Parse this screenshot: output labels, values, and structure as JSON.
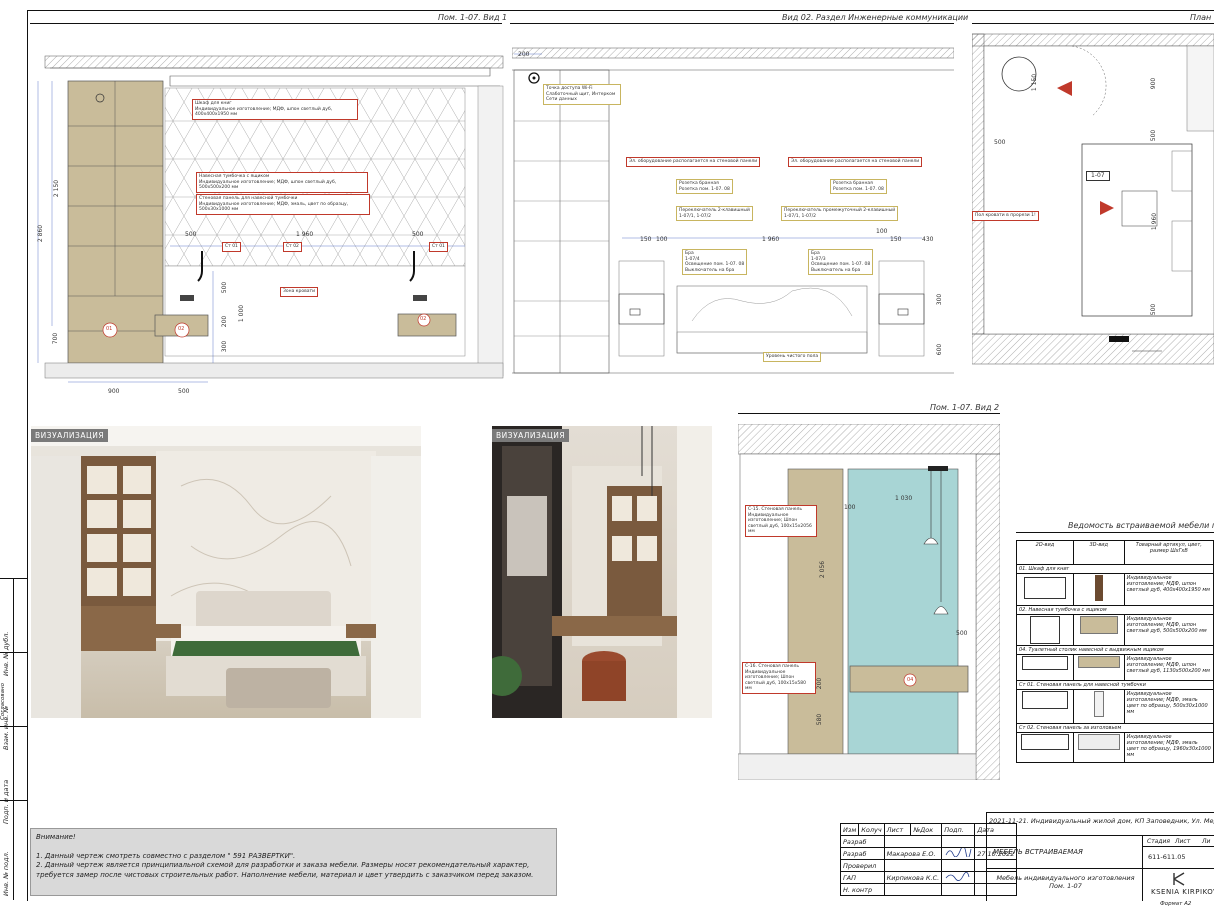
{
  "views": {
    "view1_title": "Пом. 1-07. Вид 1",
    "view2_title": "Вид 02. Раздел Инженерные коммуникации",
    "view3_title": "План",
    "view4_title": "Пом. 1-07. Вид 2",
    "specs_title": "Ведомость встраиваемой мебели по"
  },
  "view1": {
    "notes": {
      "n1": "Шкаф для книг\nИндивидуальное изготовление; МДФ, шпон светлый дуб, 400х400х1950 мм",
      "n2": "Навесная тумбочка с ящиком\nИндивидуальное изготовление; МДФ, шпон светлый дуб, 500х500х200 мм",
      "n3": "Стеновая панель для навесной тумбочки\nИндивидуальное изготовление; МДФ, эмаль, цвет по образцу, 500х30х1000 мм",
      "st01a": "Ст 01",
      "st02": "Ст 02",
      "st01b": "Ст 01",
      "bed_zone": "Зона кровати"
    },
    "dims": {
      "d2860": "2 860",
      "d2150": "2 150",
      "d1960": "1 960",
      "d500a": "500",
      "d500b": "500",
      "d500c": "500",
      "d1000": "1 000",
      "d200": "200",
      "d300": "300",
      "d700": "700",
      "d900": "900",
      "d500d": "500"
    },
    "tags": {
      "t01": "01",
      "t02": "02",
      "t02b": "02"
    }
  },
  "view2": {
    "notes": {
      "wifi": "Точка доступа Wi-Fi\nСлаботочный щит, Интерком\nСети данных",
      "equip_left": "Эл. оборудование располагается на стеновой панели",
      "equip_right": "Эл. оборудование располагается на стеновой панели",
      "socket_left": "Розетка бранная\nРозетка пом. 1-07. 08",
      "socket_right": "Розетка бранная\nРозетка пом. 1-07. 08",
      "switch_left": "Переключатель 2-клавишный\n1-07/1, 1-07/2",
      "switch_right": "Переключатель промежуточный 2-клавишный\n1-07/1, 1-07/2",
      "bra_left": "Бра\n1-07/4\nОсвещение пом. 1-07. 08\nВыключатель на бра",
      "bra_right": "Бра\n1-07/3\nОсвещение пом. 1-07. 08\nВыключатель на бра",
      "floor": "Уровень чистого пола"
    },
    "dims": {
      "d200": "200",
      "d150a": "150",
      "d100a": "100",
      "d1960": "1 960",
      "d100b": "100",
      "d150b": "150",
      "d430": "430",
      "d300": "300",
      "d600": "600"
    }
  },
  "plan": {
    "room_tag": "1-07",
    "note": "Пол кровати в прорези 1!",
    "dims": {
      "d1150": "1 150",
      "d900": "900",
      "d500a": "500",
      "d500b": "500",
      "d1960": "1 960",
      "d500c": "500"
    }
  },
  "view4": {
    "notes": {
      "c15": "С-15. Стеновая панель\nИндивидуальное изготовление; Шпон светлый дуб, 100х15х2056 мм",
      "c16": "С-16. Стеновая панель\nИндивидуальное изготовление; Шпон светлый дуб, 100х15х580 мм"
    },
    "dims": {
      "d1030": "1 030",
      "d100": "100",
      "d2056": "2 056",
      "d200": "200",
      "d580": "580",
      "d500": "500"
    },
    "tag": "04"
  },
  "visualization": {
    "label1": "ВИЗУАЛИЗАЦИЯ",
    "label2": "ВИЗУАЛИЗАЦИЯ"
  },
  "spec_table": {
    "headers": [
      "2D-вид",
      "3D-вид",
      "Товарный артикул, цвет, размер ШхГхВ"
    ],
    "rows": [
      {
        "section": "01. Шкаф для книг",
        "desc": "Индивидуальное изготовление; МДФ, шпон светлый дуб, 400х400х1950 мм"
      },
      {
        "section": "02. Навесная тумбочка с ящиком",
        "desc": "Индивидуальное изготовление; МДФ, шпон светлый дуб, 500х500х200 мм"
      },
      {
        "section": "04. Туалетный столик навесной с выдвижным ящиком",
        "desc": "Индивидуальное изготовление; МДФ, шпон светлый дуб, 1130х500х200 мм"
      },
      {
        "section": "Ст 01. Стеновая панель для навесной тумбочки",
        "desc": "Индивидуальное изготовление; МДФ, эмаль цвет по образцу, 500х30х1000 мм"
      },
      {
        "section": "Ст 02. Стеновая панель за изголовьем",
        "desc": "Индивидуальное изготовление; МДФ, эмаль цвет по образцу, 1960х30х1000 мм"
      }
    ]
  },
  "attention": {
    "title": "Внимание!",
    "line1": "1. Данный чертеж смотреть совместно с разделом \" 591 РАЗВЕРТКИ\".",
    "line2": "2. Данный чертеж является принципиальной схемой для разработки и заказа мебели. Размеры носят рекомендательный характер, требуется замер после чистовых строительных работ. Наполнение мебели, материал и цвет утвердить с заказчиком перед заказом."
  },
  "stamp": {
    "cols": [
      "Изм",
      "Колуч",
      "Лист",
      "№Док",
      "Подп.",
      "Дата"
    ],
    "rows": [
      {
        "role": "Разраб",
        "name": "",
        "date": ""
      },
      {
        "role": "Разраб",
        "name": "Макарова Е.О.",
        "date": "27.10.2022"
      },
      {
        "role": "Проверил",
        "name": "",
        "date": ""
      },
      {
        "role": "ГАП",
        "name": "Кирпикова К.С.",
        "date": ""
      },
      {
        "role": "Н. контр",
        "name": "",
        "date": ""
      }
    ],
    "project": "2021-11-21. Индивидуальный жилой дом, КП Заповедник, Ул. Медвежати",
    "section_title": "МЕБЕЛЬ ВСТРАИВАЕМАЯ",
    "sheet_title": "Мебель индивидуального изготовления\nПом. 1-07",
    "stage_label": "Стадия",
    "sheet_label": "Лист",
    "sheets_label": "Ли",
    "sheet_value": "611-611.05",
    "company": "KSENIA KIRPIKOVA",
    "format": "Формат А2"
  },
  "side_labels": [
    "Инв. № подл.",
    "Подп. и дата",
    "Взам. инв. №",
    "Инв. № дубл.",
    "Согласовано"
  ]
}
